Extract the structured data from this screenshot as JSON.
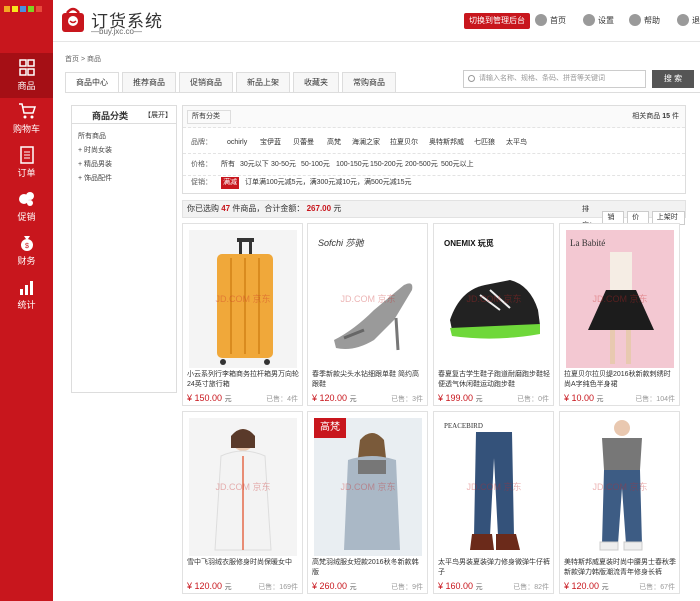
{
  "sidebar": {
    "items": [
      {
        "label": "商品",
        "icon": "grid-icon"
      },
      {
        "label": "购物车",
        "icon": "cart-icon"
      },
      {
        "label": "订单",
        "icon": "order-icon"
      },
      {
        "label": "促销",
        "icon": "promo-icon"
      },
      {
        "label": "财务",
        "icon": "money-bag-icon"
      },
      {
        "label": "统计",
        "icon": "bar-chart-icon"
      }
    ]
  },
  "header": {
    "title": "订货系统",
    "subtitle": "—buy.jxc.co—",
    "switch_label": "切换到管理后台",
    "links": [
      "首页",
      "设置",
      "帮助",
      "退"
    ]
  },
  "breadcrumb": {
    "home": "首页",
    "sep": ">",
    "current": "商品"
  },
  "tabs": [
    "商品中心",
    "推荐商品",
    "促销商品",
    "新品上架",
    "收藏夹",
    "常购商品"
  ],
  "search": {
    "placeholder": "请输入名称、规格、条码、拼音等关键词",
    "button": "搜 索"
  },
  "category": {
    "title": "商品分类",
    "expand": "【展开】",
    "items": [
      "所有商品",
      "+ 时尚女装",
      "+ 精品男装",
      "+ 饰品配件"
    ]
  },
  "filter": {
    "all_label": "所有分类",
    "related_prefix": "相关商品",
    "related_count": "15",
    "related_suffix": "件",
    "brand_label": "品牌：",
    "brands": [
      "ochirly",
      "宝伊蓝",
      "贝蕾曼",
      "高梵",
      "海澜之家",
      "拉夏贝尔",
      "奥特斯邦威",
      "七匹狼",
      "太平鸟"
    ],
    "price_label": "价格：",
    "prices": [
      "所有",
      "30元以下",
      "30-50元",
      "50-100元",
      "100-150元",
      "150-200元",
      "200-500元",
      "500元以上"
    ],
    "promo_label": "促销：",
    "promo_tag": "满减",
    "promo_text": "订单满100元减5元，满300元减10元，满500元减15元"
  },
  "summary": {
    "prefix": "你已选购",
    "count": "47",
    "mid": "件商品，合计金额：",
    "total": "267.00",
    "unit": "元",
    "sort_label": "排序：",
    "sort_options": [
      "销量",
      "价格",
      "上架时间"
    ]
  },
  "watermark": "JD.COM 京东",
  "products": [
    {
      "name": "小云系列行李箱商务拉杆箱男万向轮24英寸旅行箱",
      "price": "¥ 150.00",
      "unit": "元",
      "sold": "已售：4件"
    },
    {
      "name": "春季新款尖头水钻细跟单鞋 简约高跟鞋",
      "price": "¥ 120.00",
      "unit": "元",
      "sold": "已售：3件"
    },
    {
      "name": "春夏复古学生鞋子跑道耐磨跑步鞋轻便透气休闲鞋运动跑步鞋",
      "price": "¥ 199.00",
      "unit": "元",
      "sold": "已售：0件"
    },
    {
      "name": "拉夏贝尔拉贝缇2016秋新款刺绣时尚A字纯色半身裙",
      "price": "¥ 10.00",
      "unit": "元",
      "sold": "已售：104件"
    },
    {
      "name": "雪中飞羽绒衣服修身时尚保暖女中",
      "price": "¥ 120.00",
      "unit": "元",
      "sold": "已售：169件"
    },
    {
      "name": "高梵羽绒服女短款2016秋冬新款韩版",
      "price": "¥ 260.00",
      "unit": "元",
      "sold": "已售：9件"
    },
    {
      "name": "太平鸟男装夏装弹力修身微弹牛仔裤子",
      "price": "¥ 160.00",
      "unit": "元",
      "sold": "已售：82件"
    },
    {
      "name": "美特斯邦威夏装时尚中腰男士春秋季新款弹力韩版潮流青年修身长裤",
      "price": "¥ 120.00",
      "unit": "元",
      "sold": "已售：67件"
    }
  ],
  "product_brands": [
    "",
    "Sofchi 莎驰",
    "ONEMIX 玩觅",
    "La Babité",
    "",
    "高梵",
    "PEACEBIRD",
    ""
  ],
  "colors": {
    "brand_red": "#c8161d",
    "sidebar_active": "#a50f15"
  }
}
